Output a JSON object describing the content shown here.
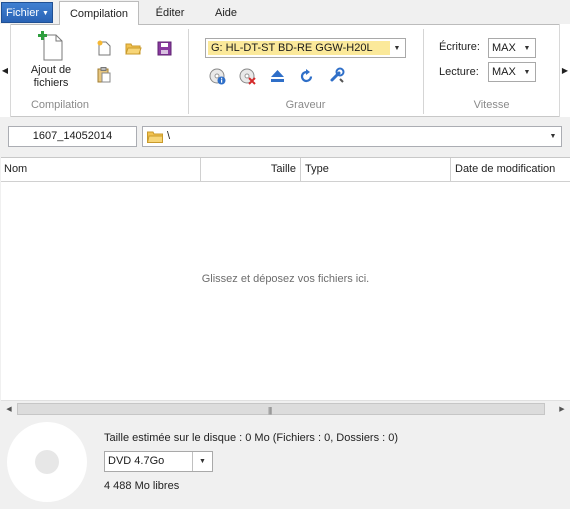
{
  "menu": {
    "file_label": "Fichier",
    "tabs": [
      {
        "label": "Compilation"
      },
      {
        "label": "Éditer"
      },
      {
        "label": "Aide"
      }
    ]
  },
  "ribbon": {
    "compilation": {
      "add_files_label_line1": "Ajout de",
      "add_files_label_line2": "fichiers",
      "group_label": "Compilation"
    },
    "burner": {
      "drive": "G: HL-DT-ST BD-RE  GGW-H20L",
      "group_label": "Graveur"
    },
    "speed": {
      "write_label": "Écriture:",
      "write_value": "MAX",
      "read_label": "Lecture:",
      "read_value": "MAX",
      "group_label": "Vitesse"
    }
  },
  "path_bar": {
    "name": "1607_14052014",
    "path": "\\"
  },
  "file_list": {
    "columns": [
      "Nom",
      "Taille",
      "Type",
      "Date de modification"
    ],
    "empty_hint": "Glissez et déposez vos fichiers ici."
  },
  "status": {
    "size_info": "Taille estimée sur le disque : 0 Mo (Fichiers : 0, Dossiers : 0)",
    "media": "DVD 4.7Go",
    "free_info": "4 488 Mo libres"
  },
  "colors": {
    "file_tab": "#2a63b5",
    "drive_highlight": "#fbe99a"
  }
}
